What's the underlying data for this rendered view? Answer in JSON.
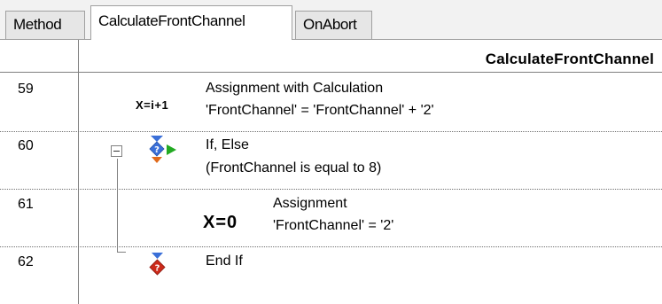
{
  "tabs": [
    {
      "label": "Method",
      "active": false
    },
    {
      "label": "CalculateFrontChannel",
      "active": true
    },
    {
      "label": "OnAbort",
      "active": false
    }
  ],
  "header": {
    "title": "CalculateFrontChannel"
  },
  "rows": [
    {
      "number": "59",
      "icon": "calculation-icon",
      "icon_text": "X=i+1",
      "title": "Assignment with Calculation",
      "detail": "'FrontChannel' = 'FrontChannel' + '2'"
    },
    {
      "number": "60",
      "icon": "if-else-icon",
      "title": "If, Else",
      "detail": "(FrontChannel is equal to 8)"
    },
    {
      "number": "61",
      "icon": "assignment-icon",
      "icon_text": "X=0",
      "title": "Assignment",
      "detail": "'FrontChannel' = '2'"
    },
    {
      "number": "62",
      "icon": "end-if-icon",
      "title": "End If",
      "detail": ""
    }
  ],
  "colors": {
    "arrow_blue": "#3a6fd8",
    "arrow_orange": "#e06a1a",
    "arrow_green": "#22aa22",
    "diamond_red": "#cc2a1a",
    "gridline": "#808080"
  }
}
